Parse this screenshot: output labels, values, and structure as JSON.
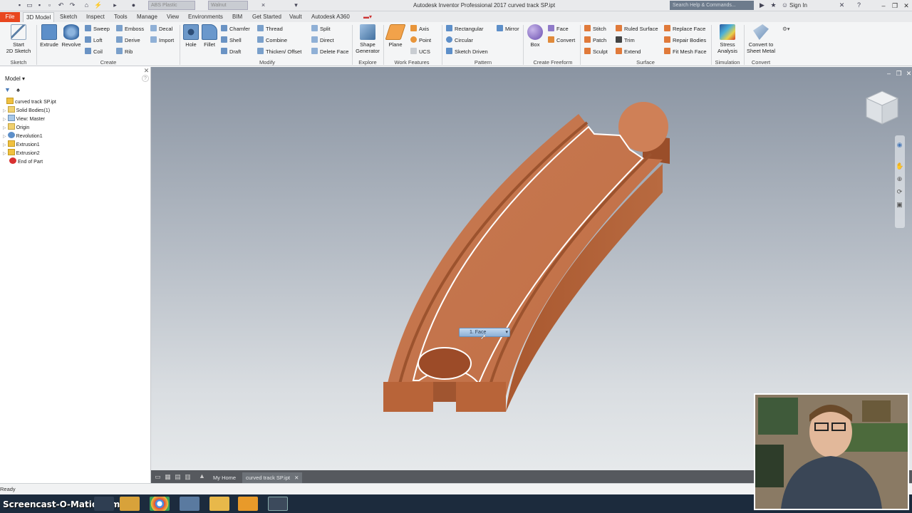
{
  "app": {
    "title": "Autodesk Inventor Professional 2017   curved track SP.ipt",
    "material": "ABS Plastic",
    "appearance": "Walnut",
    "search_placeholder": "Search Help & Commands...",
    "sign_in": "Sign In"
  },
  "menu_tabs": [
    "File",
    "3D Model",
    "Sketch",
    "Inspect",
    "Tools",
    "Manage",
    "View",
    "Environments",
    "BIM",
    "Get Started",
    "Vault",
    "Autodesk A360"
  ],
  "ribbon": {
    "sketch": {
      "start": "Start",
      "start2": "2D Sketch",
      "group": "Sketch"
    },
    "create": {
      "extrude": "Extrude",
      "revolve": "Revolve",
      "sweep": "Sweep",
      "loft": "Loft",
      "coil": "Coil",
      "emboss": "Emboss",
      "derive": "Derive",
      "rib": "Rib",
      "decal": "Decal",
      "import": "Import",
      "group": "Create"
    },
    "modify": {
      "hole": "Hole",
      "fillet": "Fillet",
      "chamfer": "Chamfer",
      "shell": "Shell",
      "draft": "Draft",
      "thread": "Thread",
      "combine": "Combine",
      "thicken": "Thicken/ Offset",
      "split": "Split",
      "direct": "Direct",
      "delete_face": "Delete Face",
      "group": "Modify"
    },
    "explore": {
      "shape": "Shape",
      "shape2": "Generator",
      "group": "Explore"
    },
    "work": {
      "plane": "Plane",
      "axis": "Axis",
      "point": "Point",
      "ucs": "UCS",
      "group": "Work Features"
    },
    "pattern": {
      "rectangular": "Rectangular",
      "circular": "Circular",
      "sketch_driven": "Sketch Driven",
      "mirror": "Mirror",
      "group": "Pattern"
    },
    "freeform": {
      "box": "Box",
      "face": "Face",
      "convert": "Convert",
      "group": "Create Freeform"
    },
    "surface": {
      "stitch": "Stitch",
      "patch": "Patch",
      "sculpt": "Sculpt",
      "ruled": "Ruled Surface",
      "trim": "Trim",
      "extend": "Extend",
      "replace": "Replace Face",
      "repair": "Repair Bodies",
      "fitmesh": "Fit Mesh Face",
      "group": "Surface"
    },
    "simulation": {
      "stress": "Stress",
      "stress2": "Analysis",
      "group": "Simulation"
    },
    "convert": {
      "sheet": "Convert to",
      "sheet2": "Sheet Metal",
      "group": "Convert"
    }
  },
  "browser": {
    "title": "Model",
    "items": [
      "curved track SP.ipt",
      "Solid Bodies(1)",
      "View: Master",
      "Origin",
      "Revolution1",
      "Extrusion1",
      "Extrusion2",
      "End of Part"
    ]
  },
  "selection_tooltip": "1. Face",
  "doc_tabs": {
    "home": "My Home",
    "part": "curved track SP.ipt"
  },
  "status": "Ready",
  "watermark": "Screencast-O-Matic.com",
  "colors": {
    "part": "#c9744a",
    "part_dark": "#a55a35",
    "highlight": "#ffffff",
    "file_tab": "#e8461f"
  }
}
